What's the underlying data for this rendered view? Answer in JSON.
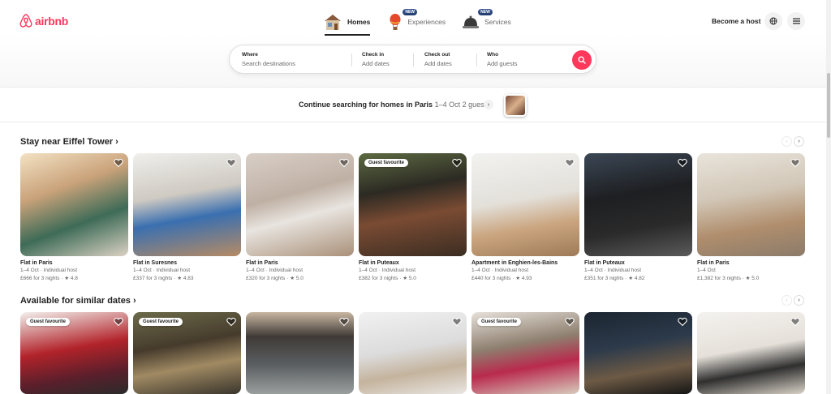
{
  "brand": {
    "name": "airbnb",
    "color": "#ff385c"
  },
  "nav": {
    "tabs": [
      {
        "label": "Homes",
        "icon": "house-icon",
        "badge": ""
      },
      {
        "label": "Experiences",
        "icon": "balloon-icon",
        "badge": "NEW"
      },
      {
        "label": "Services",
        "icon": "bell-icon",
        "badge": "NEW"
      }
    ],
    "host_label": "Become a host",
    "globe_icon": "globe-icon",
    "menu_icon": "menu-icon"
  },
  "search": {
    "where_label": "Where",
    "where_placeholder": "Search destinations",
    "checkin_label": "Check in",
    "checkin_placeholder": "Add dates",
    "checkout_label": "Check out",
    "checkout_placeholder": "Add dates",
    "who_label": "Who",
    "who_placeholder": "Add guests",
    "button_icon": "search-icon"
  },
  "continue": {
    "text": "Continue searching for homes in Paris",
    "dates": "1–4 Oct",
    "guests": "2 guests"
  },
  "sections": [
    {
      "title": "Stay near Eiffel Tower",
      "listings": [
        {
          "title": "Flat in Paris",
          "sub": "1–4 Oct · Individual host",
          "price": "£666 for 3 nights · ★ 4.8",
          "favourite": ""
        },
        {
          "title": "Flat in Suresnes",
          "sub": "1–4 Oct · Individual host",
          "price": "£337 for 3 nights · ★ 4.83",
          "favourite": ""
        },
        {
          "title": "Flat in Paris",
          "sub": "1–4 Oct · Individual host",
          "price": "£320 for 3 nights · ★ 5.0",
          "favourite": ""
        },
        {
          "title": "Flat in Puteaux",
          "sub": "1–4 Oct · Individual host",
          "price": "£382 for 3 nights · ★ 5.0",
          "favourite": "Guest favourite"
        },
        {
          "title": "Apartment in Enghien-les-Bains",
          "sub": "1–4 Oct · Individual host",
          "price": "£440 for 3 nights · ★ 4.93",
          "favourite": ""
        },
        {
          "title": "Flat in Puteaux",
          "sub": "1–4 Oct · Individual host",
          "price": "£351 for 3 nights · ★ 4.82",
          "favourite": ""
        },
        {
          "title": "Flat in Paris",
          "sub": "1–4 Oct",
          "price": "£1,382 for 3 nights · ★ 5.0",
          "favourite": ""
        }
      ]
    },
    {
      "title": "Available for similar dates",
      "listings": [
        {
          "favourite": "Guest favourite"
        },
        {
          "favourite": "Guest favourite"
        },
        {
          "favourite": ""
        },
        {
          "favourite": ""
        },
        {
          "favourite": "Guest favourite"
        },
        {
          "favourite": ""
        },
        {
          "favourite": ""
        }
      ]
    }
  ],
  "colors": {
    "accent": "#ff385c",
    "text": "#222222",
    "muted": "#6a6a6a"
  }
}
